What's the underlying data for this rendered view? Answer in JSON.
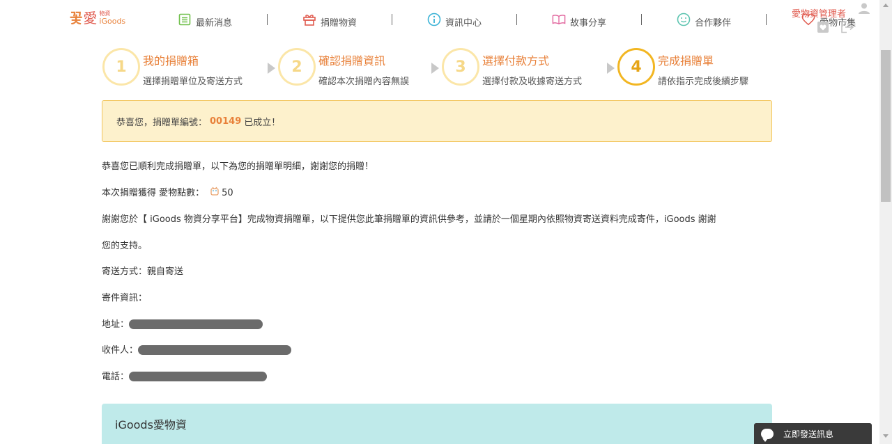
{
  "logo": {
    "mark": "꽃",
    "ai": "愛",
    "sub_top": "物資",
    "sub_brand": "iGoods"
  },
  "nav": [
    {
      "label": "最新消息",
      "icon": "list-icon"
    },
    {
      "label": "捐贈物資",
      "icon": "gift-icon"
    },
    {
      "label": "資訊中心",
      "icon": "info-icon"
    },
    {
      "label": "故事分享",
      "icon": "book-icon"
    },
    {
      "label": "合作夥伴",
      "icon": "smile-icon"
    },
    {
      "label": "愛物市集",
      "icon": "heart-icon"
    }
  ],
  "user": {
    "name": "愛物資管理者"
  },
  "steps": [
    {
      "num": "1",
      "title": "我的捐贈箱",
      "desc": "選擇捐贈單位及寄送方式"
    },
    {
      "num": "2",
      "title": "確認捐贈資訊",
      "desc": "確認本次捐贈內容無誤"
    },
    {
      "num": "3",
      "title": "選擇付款方式",
      "desc": "選擇付款及收據寄送方式"
    },
    {
      "num": "4",
      "title": "完成捐贈單",
      "desc": "請依指示完成後續步驟"
    }
  ],
  "success": {
    "prefix": "恭喜您，捐贈單編號：",
    "number": "00149",
    "suffix": "已成立！"
  },
  "content": {
    "thanks": "恭喜您已順利完成捐贈單，以下為您的捐贈單明細，謝謝您的捐贈！",
    "points_label": "本次捐贈獲得 愛物點數：",
    "points_value": "50",
    "notice_line1": "謝謝您於【 iGoods 物資分享平台】完成物資捐贈單，以下提供您此筆捐贈單的資訊供參考，並請於一個星期內依照物資寄送資料完成寄件，iGoods 謝謝",
    "notice_line2": "您的支持。",
    "delivery": "寄送方式：親自寄送",
    "sender_info": "寄件資訊：",
    "address_label": "地址：",
    "recipient_label": "收件人：",
    "phone_label": "電話："
  },
  "panel": {
    "title": "iGoods愛物資"
  },
  "chat": {
    "label": "立即發送訊息"
  },
  "colors": {
    "accent": "#e8813a",
    "brand_red": "#e05a4e",
    "step_active": "#f2b622",
    "panel_bg": "#bfeaea"
  }
}
